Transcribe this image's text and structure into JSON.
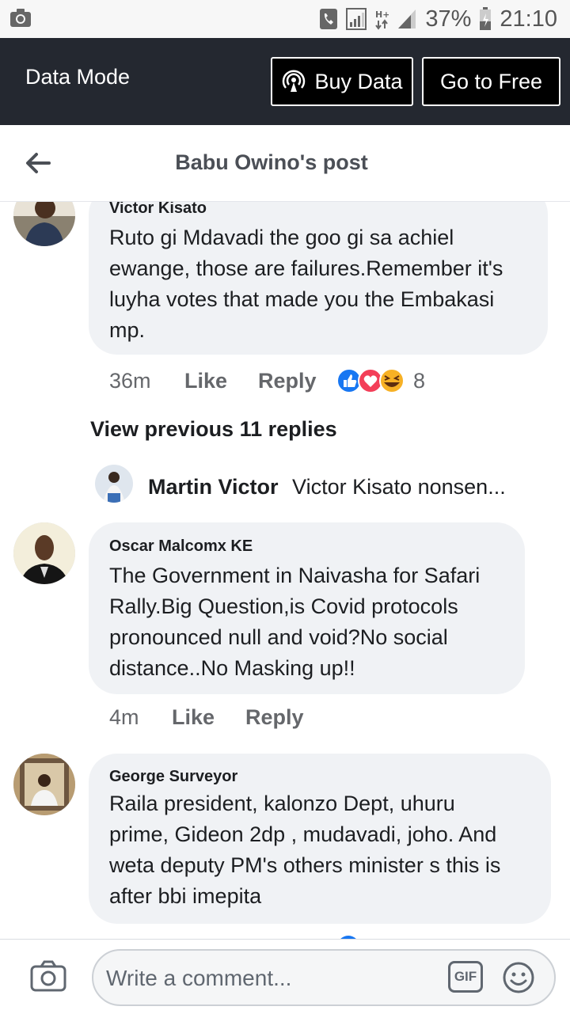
{
  "status_bar": {
    "battery": "37%",
    "time": "21:10"
  },
  "data_bar": {
    "label": "Data Mode",
    "buy_data": "Buy Data",
    "go_free": "Go to Free"
  },
  "header": {
    "title": "Babu Owino's post"
  },
  "comments": [
    {
      "author": "Victor Kisato",
      "lines": [
        "Ruto gi Mdavadi the goo gi sa achiel",
        "ewange, those are failures.Remember it's",
        "luyha votes that made you the Embakasi",
        "mp."
      ],
      "time": "36m",
      "like": "Like",
      "reply": "Reply",
      "reaction_count": "8"
    },
    {
      "author": "Oscar Malcomx KE",
      "lines": [
        "The Government in Naivasha for Safari",
        "Rally.Big Question,is Covid protocols",
        "pronounced null and void?No social",
        "distance..No Masking up!!"
      ],
      "time": "4m",
      "like": "Like",
      "reply": "Reply"
    },
    {
      "author": "George Surveyor",
      "lines": [
        "Raila president, kalonzo Dept, uhuru",
        "prime,  Gideon 2dp , mudavadi, joho. And",
        "weta deputy PM's others minister s this is",
        "after bbi imepita"
      ]
    }
  ],
  "view_previous": "View previous 11 replies",
  "reply_preview": {
    "author": "Martin Victor",
    "text": "Victor Kisato nonsen..."
  },
  "composer": {
    "placeholder": "Write a comment...",
    "gif": "GIF"
  },
  "colors": {
    "data_bar_bg": "#242830",
    "bubble_bg": "#f0f2f5",
    "like_blue": "#1877f2",
    "love_red": "#f33e58",
    "haha_yellow": "#f7b125"
  }
}
